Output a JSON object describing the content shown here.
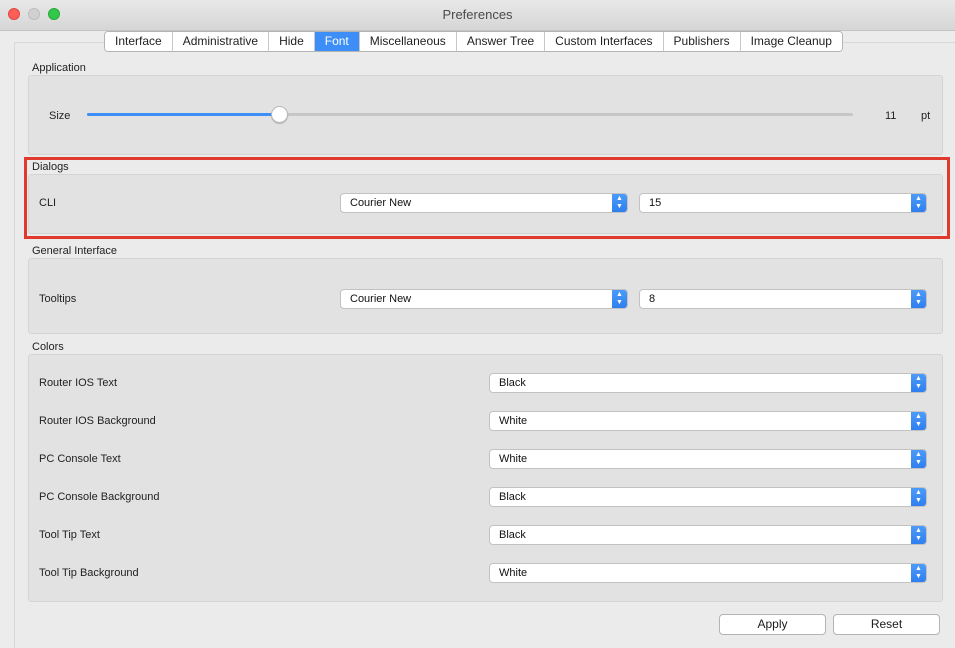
{
  "window": {
    "title": "Preferences"
  },
  "tabs": [
    "Interface",
    "Administrative",
    "Hide",
    "Font",
    "Miscellaneous",
    "Answer Tree",
    "Custom Interfaces",
    "Publishers",
    "Image Cleanup"
  ],
  "active_tab": "Font",
  "application": {
    "section_label": "Application",
    "size_label": "Size",
    "size_value": "11",
    "size_unit": "pt",
    "slider_level": 0.25
  },
  "dialogs": {
    "section_label": "Dialogs",
    "cli_label": "CLI",
    "cli_font": "Courier New",
    "cli_size": "15"
  },
  "general_interface": {
    "section_label": "General Interface",
    "tooltips_label": "Tooltips",
    "tooltips_font": "Courier New",
    "tooltips_size": "8"
  },
  "colors": {
    "section_label": "Colors",
    "rows": [
      {
        "label": "Router IOS Text",
        "value": "Black"
      },
      {
        "label": "Router IOS Background",
        "value": "White"
      },
      {
        "label": "PC Console Text",
        "value": "White"
      },
      {
        "label": "PC Console Background",
        "value": "Black"
      },
      {
        "label": "Tool Tip Text",
        "value": "Black"
      },
      {
        "label": "Tool Tip Background",
        "value": "White"
      }
    ]
  },
  "buttons": {
    "apply": "Apply",
    "reset": "Reset"
  },
  "theme": {
    "accent": "#3d8ef6",
    "highlight_border": "#e03a2e"
  }
}
